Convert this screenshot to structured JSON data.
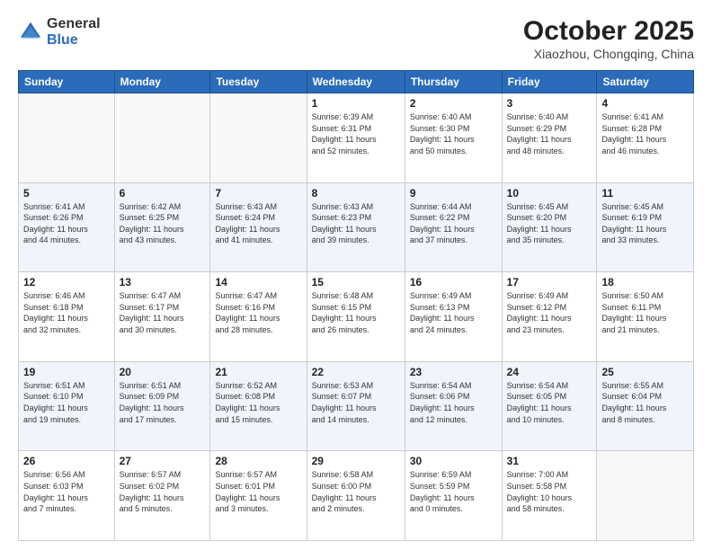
{
  "header": {
    "logo_general": "General",
    "logo_blue": "Blue",
    "month_title": "October 2025",
    "location": "Xiaozhou, Chongqing, China"
  },
  "days_of_week": [
    "Sunday",
    "Monday",
    "Tuesday",
    "Wednesday",
    "Thursday",
    "Friday",
    "Saturday"
  ],
  "weeks": [
    [
      {
        "day": "",
        "info": ""
      },
      {
        "day": "",
        "info": ""
      },
      {
        "day": "",
        "info": ""
      },
      {
        "day": "1",
        "info": "Sunrise: 6:39 AM\nSunset: 6:31 PM\nDaylight: 11 hours\nand 52 minutes."
      },
      {
        "day": "2",
        "info": "Sunrise: 6:40 AM\nSunset: 6:30 PM\nDaylight: 11 hours\nand 50 minutes."
      },
      {
        "day": "3",
        "info": "Sunrise: 6:40 AM\nSunset: 6:29 PM\nDaylight: 11 hours\nand 48 minutes."
      },
      {
        "day": "4",
        "info": "Sunrise: 6:41 AM\nSunset: 6:28 PM\nDaylight: 11 hours\nand 46 minutes."
      }
    ],
    [
      {
        "day": "5",
        "info": "Sunrise: 6:41 AM\nSunset: 6:26 PM\nDaylight: 11 hours\nand 44 minutes."
      },
      {
        "day": "6",
        "info": "Sunrise: 6:42 AM\nSunset: 6:25 PM\nDaylight: 11 hours\nand 43 minutes."
      },
      {
        "day": "7",
        "info": "Sunrise: 6:43 AM\nSunset: 6:24 PM\nDaylight: 11 hours\nand 41 minutes."
      },
      {
        "day": "8",
        "info": "Sunrise: 6:43 AM\nSunset: 6:23 PM\nDaylight: 11 hours\nand 39 minutes."
      },
      {
        "day": "9",
        "info": "Sunrise: 6:44 AM\nSunset: 6:22 PM\nDaylight: 11 hours\nand 37 minutes."
      },
      {
        "day": "10",
        "info": "Sunrise: 6:45 AM\nSunset: 6:20 PM\nDaylight: 11 hours\nand 35 minutes."
      },
      {
        "day": "11",
        "info": "Sunrise: 6:45 AM\nSunset: 6:19 PM\nDaylight: 11 hours\nand 33 minutes."
      }
    ],
    [
      {
        "day": "12",
        "info": "Sunrise: 6:46 AM\nSunset: 6:18 PM\nDaylight: 11 hours\nand 32 minutes."
      },
      {
        "day": "13",
        "info": "Sunrise: 6:47 AM\nSunset: 6:17 PM\nDaylight: 11 hours\nand 30 minutes."
      },
      {
        "day": "14",
        "info": "Sunrise: 6:47 AM\nSunset: 6:16 PM\nDaylight: 11 hours\nand 28 minutes."
      },
      {
        "day": "15",
        "info": "Sunrise: 6:48 AM\nSunset: 6:15 PM\nDaylight: 11 hours\nand 26 minutes."
      },
      {
        "day": "16",
        "info": "Sunrise: 6:49 AM\nSunset: 6:13 PM\nDaylight: 11 hours\nand 24 minutes."
      },
      {
        "day": "17",
        "info": "Sunrise: 6:49 AM\nSunset: 6:12 PM\nDaylight: 11 hours\nand 23 minutes."
      },
      {
        "day": "18",
        "info": "Sunrise: 6:50 AM\nSunset: 6:11 PM\nDaylight: 11 hours\nand 21 minutes."
      }
    ],
    [
      {
        "day": "19",
        "info": "Sunrise: 6:51 AM\nSunset: 6:10 PM\nDaylight: 11 hours\nand 19 minutes."
      },
      {
        "day": "20",
        "info": "Sunrise: 6:51 AM\nSunset: 6:09 PM\nDaylight: 11 hours\nand 17 minutes."
      },
      {
        "day": "21",
        "info": "Sunrise: 6:52 AM\nSunset: 6:08 PM\nDaylight: 11 hours\nand 15 minutes."
      },
      {
        "day": "22",
        "info": "Sunrise: 6:53 AM\nSunset: 6:07 PM\nDaylight: 11 hours\nand 14 minutes."
      },
      {
        "day": "23",
        "info": "Sunrise: 6:54 AM\nSunset: 6:06 PM\nDaylight: 11 hours\nand 12 minutes."
      },
      {
        "day": "24",
        "info": "Sunrise: 6:54 AM\nSunset: 6:05 PM\nDaylight: 11 hours\nand 10 minutes."
      },
      {
        "day": "25",
        "info": "Sunrise: 6:55 AM\nSunset: 6:04 PM\nDaylight: 11 hours\nand 8 minutes."
      }
    ],
    [
      {
        "day": "26",
        "info": "Sunrise: 6:56 AM\nSunset: 6:03 PM\nDaylight: 11 hours\nand 7 minutes."
      },
      {
        "day": "27",
        "info": "Sunrise: 6:57 AM\nSunset: 6:02 PM\nDaylight: 11 hours\nand 5 minutes."
      },
      {
        "day": "28",
        "info": "Sunrise: 6:57 AM\nSunset: 6:01 PM\nDaylight: 11 hours\nand 3 minutes."
      },
      {
        "day": "29",
        "info": "Sunrise: 6:58 AM\nSunset: 6:00 PM\nDaylight: 11 hours\nand 2 minutes."
      },
      {
        "day": "30",
        "info": "Sunrise: 6:59 AM\nSunset: 5:59 PM\nDaylight: 11 hours\nand 0 minutes."
      },
      {
        "day": "31",
        "info": "Sunrise: 7:00 AM\nSunset: 5:58 PM\nDaylight: 10 hours\nand 58 minutes."
      },
      {
        "day": "",
        "info": ""
      }
    ]
  ]
}
